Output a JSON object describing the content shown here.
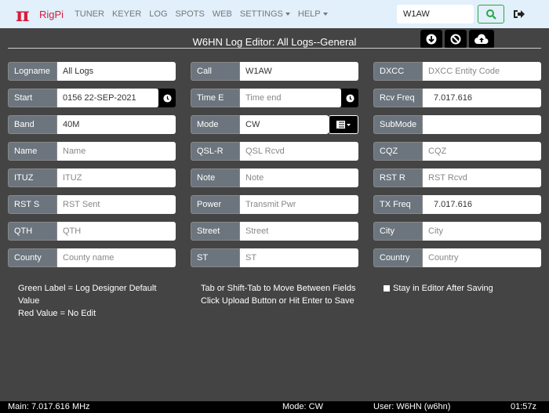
{
  "nav": {
    "brand": "RigPi",
    "items": [
      "TUNER",
      "KEYER",
      "LOG",
      "SPOTS",
      "WEB"
    ],
    "settings": "SETTINGS",
    "help": "HELP",
    "search_value": "W1AW"
  },
  "header": {
    "title": "W6HN Log Editor: All Logs--General"
  },
  "fields": {
    "logname": {
      "label": "Logname",
      "value": "All Logs"
    },
    "start": {
      "label": "Start",
      "value": "0156 22-SEP-2021"
    },
    "band": {
      "label": "Band",
      "value": "40M"
    },
    "name": {
      "label": "Name",
      "value": "Name"
    },
    "ituz": {
      "label": "ITUZ",
      "value": "ITUZ"
    },
    "rsts": {
      "label": "RST S",
      "value": "RST Sent"
    },
    "qth": {
      "label": "QTH",
      "value": "QTH"
    },
    "county": {
      "label": "County",
      "value": "County name"
    },
    "call": {
      "label": "Call",
      "value": "W1AW"
    },
    "timee": {
      "label": "Time E",
      "value": "Time end"
    },
    "mode": {
      "label": "Mode",
      "value": "CW"
    },
    "qslr": {
      "label": "QSL-R",
      "value": "QSL Rcvd"
    },
    "note": {
      "label": "Note",
      "value": "Note"
    },
    "power": {
      "label": "Power",
      "value": "Transmit Pwr"
    },
    "street": {
      "label": "Street",
      "value": "Street"
    },
    "st": {
      "label": "ST",
      "value": "ST"
    },
    "dxcc": {
      "label": "DXCC",
      "value": "DXCC Entity Code"
    },
    "rcvfreq": {
      "label": "Rcv Freq",
      "value": "7.017.616"
    },
    "submode": {
      "label": "SubMode",
      "value": ""
    },
    "cqz": {
      "label": "CQZ",
      "value": "CQZ"
    },
    "rstr": {
      "label": "RST R",
      "value": "RST Rcvd"
    },
    "txfreq": {
      "label": "TX Freq",
      "value": "7.017.616"
    },
    "city": {
      "label": "City",
      "value": "City"
    },
    "country": {
      "label": "Country",
      "value": "Country"
    }
  },
  "notes": {
    "green1": "Green Label = Log Designer Default",
    "green2": "Value",
    "red": "Red Value = No Edit",
    "tab": "Tab or Shift-Tab to Move Between Fields",
    "save": "Click Upload Button or Hit Enter to Save",
    "stay": "Stay in Editor After Saving"
  },
  "status": {
    "main": "Main: 7.017.616 MHz",
    "mode": "Mode: CW",
    "user": "User: W6HN (w6hn)",
    "time": "01:57z"
  }
}
